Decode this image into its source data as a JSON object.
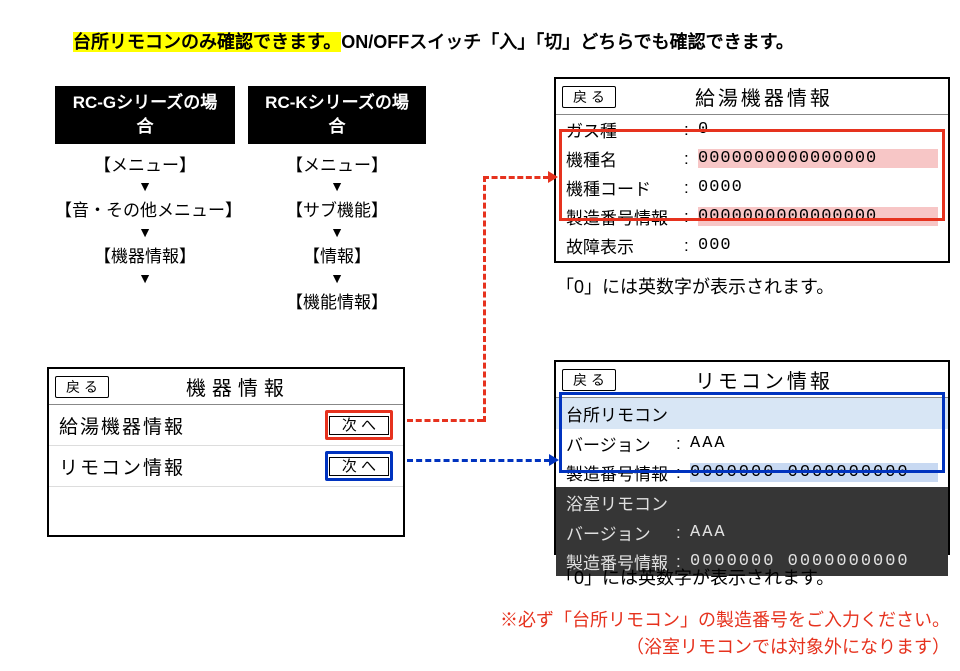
{
  "top": {
    "highlight": "台所リモコンのみ確認できます。",
    "rest": "ON/OFFスイッチ「入」「切」どちらでも確認できます。"
  },
  "flows": {
    "g": {
      "chip": "RC-Gシリーズの場合",
      "s1": "【メニュー】",
      "s2": "【音・その他メニュー】",
      "s3": "【機器情報】"
    },
    "k": {
      "chip": "RC-Kシリーズの場合",
      "s1": "【メニュー】",
      "s2": "【サブ機能】",
      "s3": "【情報】",
      "s4": "【機能情報】"
    }
  },
  "panel1": {
    "back": "戻 る",
    "title": "機器情報",
    "row1": {
      "label": "給湯機器情報",
      "btn": "次 へ"
    },
    "row2": {
      "label": "リモコン情報",
      "btn": "次 へ"
    }
  },
  "panel2": {
    "back": "戻 る",
    "title": "給湯機器情報",
    "gas_label": "ガス種",
    "gas_val": "0",
    "model_label": "機種名",
    "model_val": "0000000000000000",
    "code_label": "機種コード",
    "code_val": "0000",
    "serial_label": "製造番号情報",
    "serial_val": "0000000000000000",
    "fault_label": "故障表示",
    "fault_val": "000",
    "note": "「0」には英数字が表示されます。"
  },
  "panel3": {
    "back": "戻 る",
    "title": "リモコン情報",
    "kitchen_hdr": "台所リモコン",
    "bath_hdr": "浴室リモコン",
    "ver_label": "バージョン",
    "serial_label": "製造番号情報",
    "k_ver": "AAA",
    "k_serial": "0000000 0000000000",
    "b_ver": "AAA",
    "b_serial": "0000000 0000000000",
    "note": "「0」には英数字が表示されます。"
  },
  "footer": {
    "l1": "※必ず「台所リモコン」の製造番号をご入力ください。",
    "l2": "（浴室リモコンでは対象外になります）"
  }
}
